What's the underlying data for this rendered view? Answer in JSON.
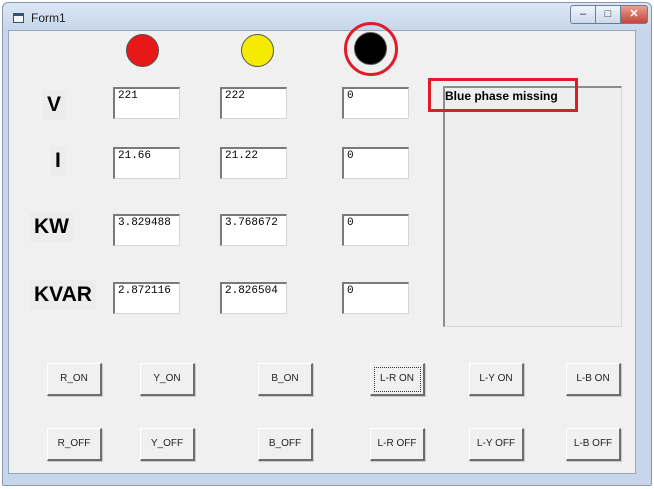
{
  "window": {
    "title": "Form1",
    "icon": "form-icon",
    "controls": {
      "minimize": "–",
      "maximize": "□",
      "close": "✕"
    }
  },
  "lamps": [
    {
      "name": "red-phase-lamp",
      "color": "#e81818"
    },
    {
      "name": "yellow-phase-lamp",
      "color": "#f6ea00"
    },
    {
      "name": "blue-phase-lamp",
      "color": "#000000"
    }
  ],
  "rows": [
    {
      "label": "V",
      "values": [
        "221",
        "222",
        "0"
      ]
    },
    {
      "label": "I",
      "values": [
        "21.66",
        "21.22",
        "0"
      ]
    },
    {
      "label": "KW",
      "values": [
        "3.829488",
        "3.768672",
        "0"
      ]
    },
    {
      "label": "KVAR",
      "values": [
        "2.872116",
        "2.826504",
        "0"
      ]
    }
  ],
  "status_list": {
    "items": [
      "Blue phase missing"
    ]
  },
  "buttons_on": [
    "R_ON",
    "Y_ON",
    "B_ON",
    "L-R ON",
    "L-Y ON",
    "L-B ON"
  ],
  "buttons_off": [
    "R_OFF",
    "Y_OFF",
    "B_OFF",
    "L-R OFF",
    "L-Y OFF",
    "L-B OFF"
  ],
  "highlight_color": "#e01b2a"
}
